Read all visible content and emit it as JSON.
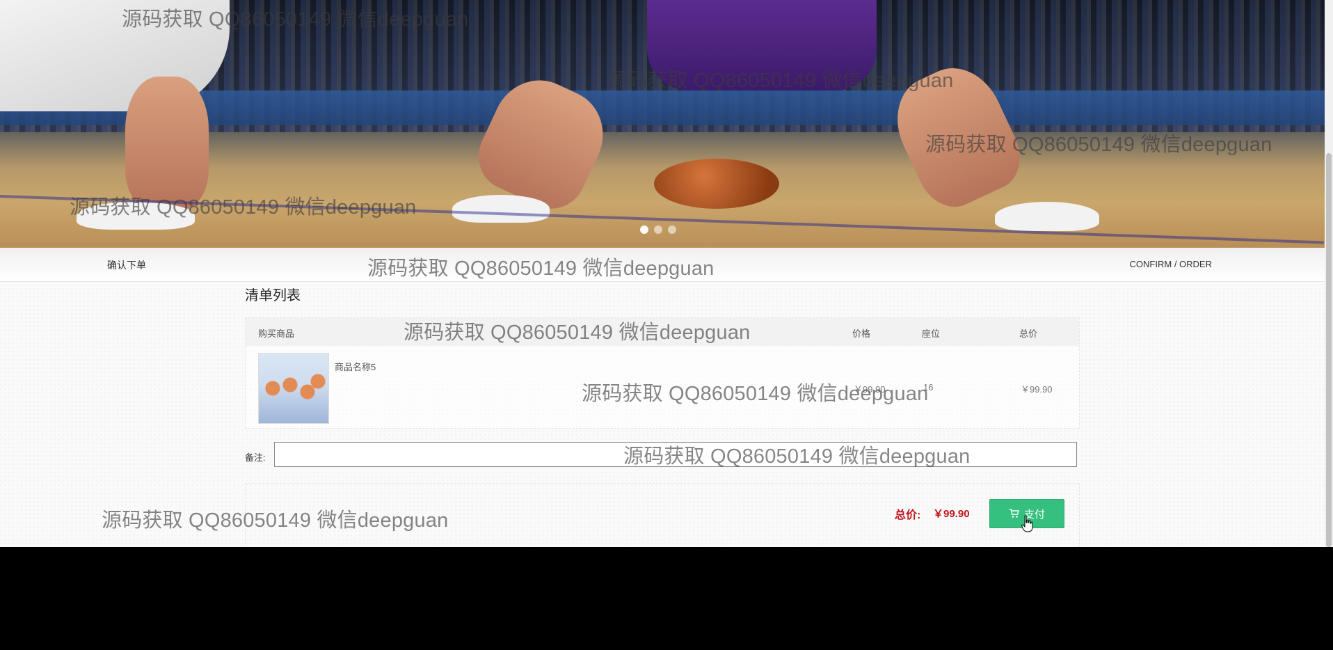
{
  "page": {
    "title_left": "确认下单",
    "title_right": "CONFIRM / ORDER",
    "section_title": "清单列表"
  },
  "table": {
    "headers": {
      "product": "购买商品",
      "price": "价格",
      "seat": "座位",
      "total": "总价"
    },
    "rows": [
      {
        "name": "商品名称5",
        "price": "￥99.90",
        "seat": "16",
        "total": "￥99.90"
      }
    ]
  },
  "note": {
    "label": "备注:",
    "value": ""
  },
  "summary": {
    "total_label": "总价:",
    "total_value": "￥99.90",
    "pay_label": "支付"
  },
  "carousel": {
    "slide_count": 3,
    "active_index": 0
  },
  "watermark": "源码获取 QQ86050149 微信deepguan",
  "colors": {
    "pay_button": "#35c07f",
    "total_text": "#c0121c",
    "background_below": "#000000"
  },
  "icons": [
    "cart-icon",
    "cursor-hand-icon"
  ]
}
